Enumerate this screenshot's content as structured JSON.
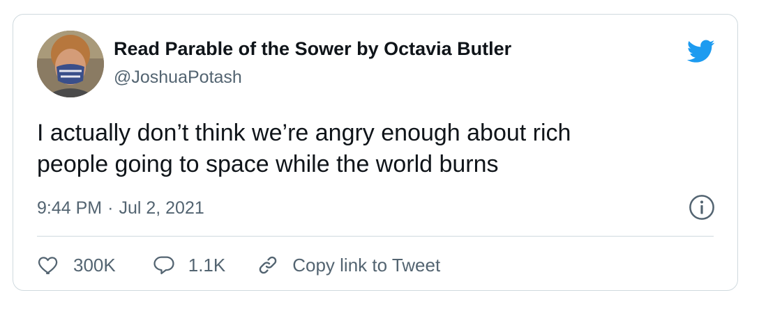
{
  "tweet": {
    "display_name": "Read Parable of the Sower by Octavia Butler",
    "handle": "@JoshuaPotash",
    "text_line1": "I actually don’t think we’re angry enough about rich",
    "text_line2": "people going to space while the world burns",
    "time": "9:44 PM",
    "separator": "·",
    "date": "Jul 2, 2021"
  },
  "actions": {
    "likes": "300K",
    "replies": "1.1K",
    "copy_link": "Copy link to Tweet"
  },
  "icons": {
    "brand": "twitter-bird-icon",
    "info": "info-icon",
    "like": "heart-icon",
    "reply": "speech-bubble-icon",
    "link": "link-icon"
  },
  "colors": {
    "brand_blue": "#1d9bf0",
    "text_primary": "#0f1419",
    "text_secondary": "#536471",
    "border": "#cfd9de"
  }
}
